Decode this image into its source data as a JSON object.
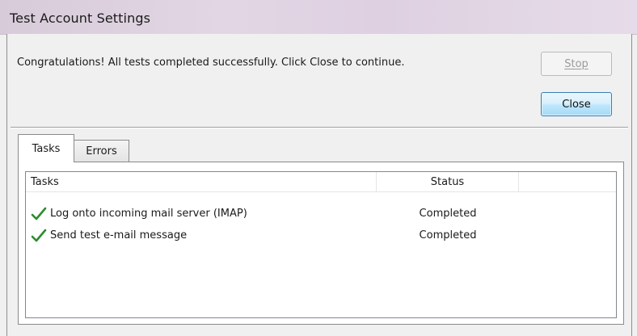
{
  "window": {
    "title": "Test Account Settings"
  },
  "message": "Congratulations! All tests completed successfully. Click Close to continue.",
  "buttons": {
    "stop_label": "Stop",
    "stop_enabled": false,
    "close_label": "Close"
  },
  "tabs": [
    {
      "label": "Tasks",
      "selected": true
    },
    {
      "label": "Errors",
      "selected": false
    }
  ],
  "tasks_list": {
    "columns": [
      "Tasks",
      "Status"
    ],
    "rows": [
      {
        "icon": "checkmark-icon",
        "task": "Log onto incoming mail server (IMAP)",
        "status": "Completed"
      },
      {
        "icon": "checkmark-icon",
        "task": "Send test e-mail message",
        "status": "Completed"
      }
    ]
  },
  "colors": {
    "check_green": "#2e8b2e",
    "close_border": "#3c7fb1"
  }
}
